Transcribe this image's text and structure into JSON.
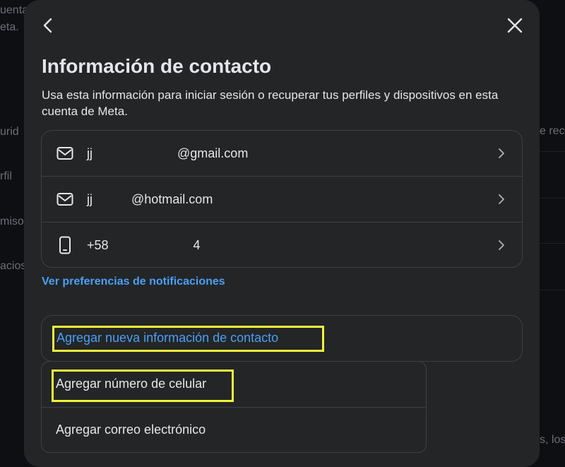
{
  "background": {
    "fragments": [
      "uenta",
      "eta.",
      "urid",
      "rfil",
      "miso",
      "acios",
      "e rec",
      "s, los"
    ]
  },
  "modal": {
    "title": "Información de contacto",
    "description": "Usa esta información para iniciar sesión o recuperar tus perfiles y dispositivos en esta cuenta de Meta.",
    "contacts": [
      {
        "icon": "mail-icon",
        "value": "jj                        @gmail.com"
      },
      {
        "icon": "mail-icon",
        "value": "jj           @hotmail.com"
      },
      {
        "icon": "phone-icon",
        "value": "+58                        4"
      }
    ],
    "notifications_link": "Ver preferencias de notificaciones",
    "add_contact_label": "Agregar nueva información de contacto",
    "menu": {
      "items": [
        {
          "label": "Agregar número de celular"
        },
        {
          "label": "Agregar correo electrónico"
        }
      ]
    }
  },
  "colors": {
    "modal_bg": "#242526",
    "link": "#4a9ff5",
    "highlight": "#eef53a",
    "border": "#3e4042"
  }
}
